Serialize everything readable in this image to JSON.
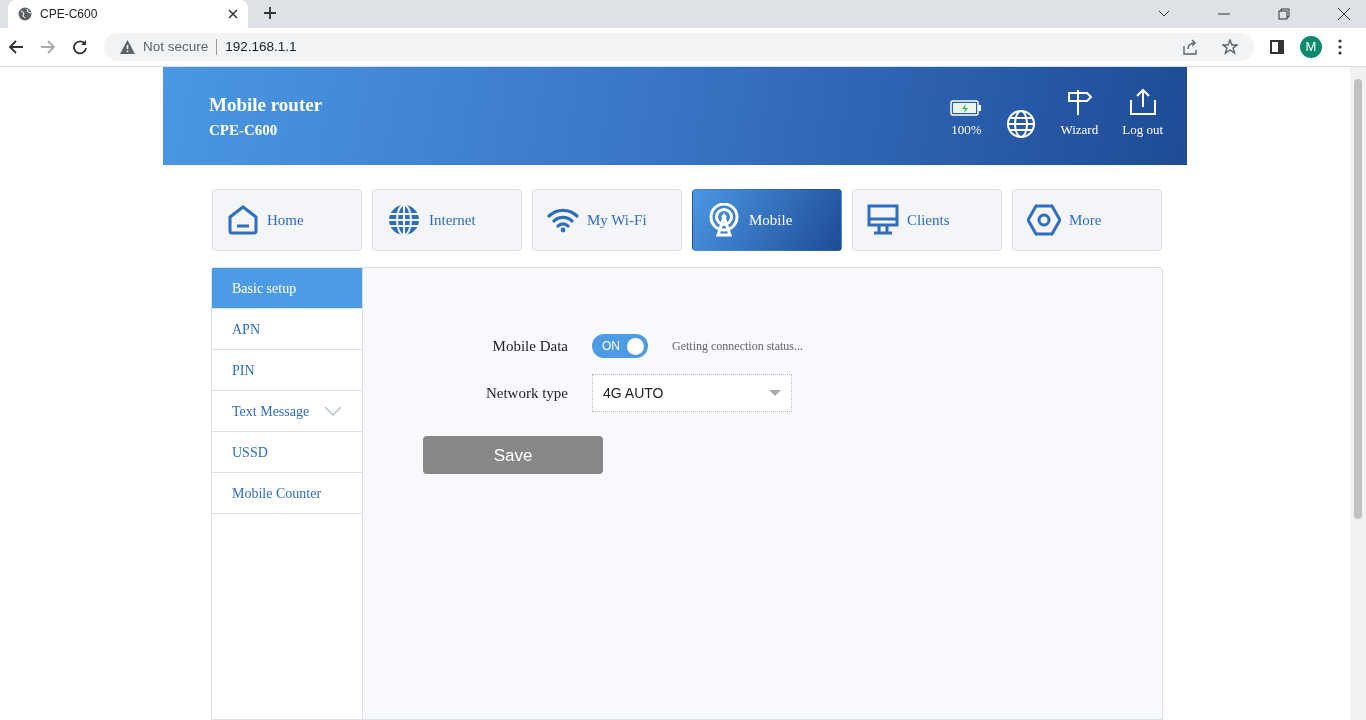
{
  "browser": {
    "tab_title": "CPE-C600",
    "security": "Not secure",
    "url": "192.168.1.1",
    "profile": "M"
  },
  "header": {
    "title": "Mobile router",
    "subtitle": "CPE-C600",
    "actions": [
      {
        "kind": "battery",
        "label": "100%",
        "level": 1
      },
      {
        "kind": "globe"
      },
      {
        "kind": "wizard",
        "label": "Wizard"
      },
      {
        "kind": "logout",
        "label": "Log out"
      }
    ]
  },
  "nav": [
    {
      "kind": "home",
      "label": "Home",
      "selected": false
    },
    {
      "kind": "internet",
      "label": "Internet",
      "selected": false
    },
    {
      "kind": "wifi",
      "label": "My Wi-Fi",
      "selected": false
    },
    {
      "kind": "mobile",
      "label": "Mobile",
      "selected": true
    },
    {
      "kind": "clients",
      "label": "Clients",
      "selected": false
    },
    {
      "kind": "more",
      "label": "More",
      "selected": false
    }
  ],
  "sidebar": {
    "items": [
      {
        "label": "Basic setup",
        "selected": true,
        "has_submenu": false
      },
      {
        "label": "APN",
        "selected": false,
        "has_submenu": false
      },
      {
        "label": "PIN",
        "selected": false,
        "has_submenu": false
      },
      {
        "label": "Text Message",
        "selected": false,
        "has_submenu": true
      },
      {
        "label": "USSD",
        "selected": false,
        "has_submenu": false
      },
      {
        "label": "Mobile Counter",
        "selected": false,
        "has_submenu": false
      }
    ]
  },
  "form": {
    "mobile_data": {
      "label": "Mobile Data",
      "on": true,
      "toggle_text": "ON",
      "status": "Getting connection status..."
    },
    "network_type": {
      "label": "Network type",
      "value": "4G AUTO"
    },
    "save_button": "Save"
  }
}
